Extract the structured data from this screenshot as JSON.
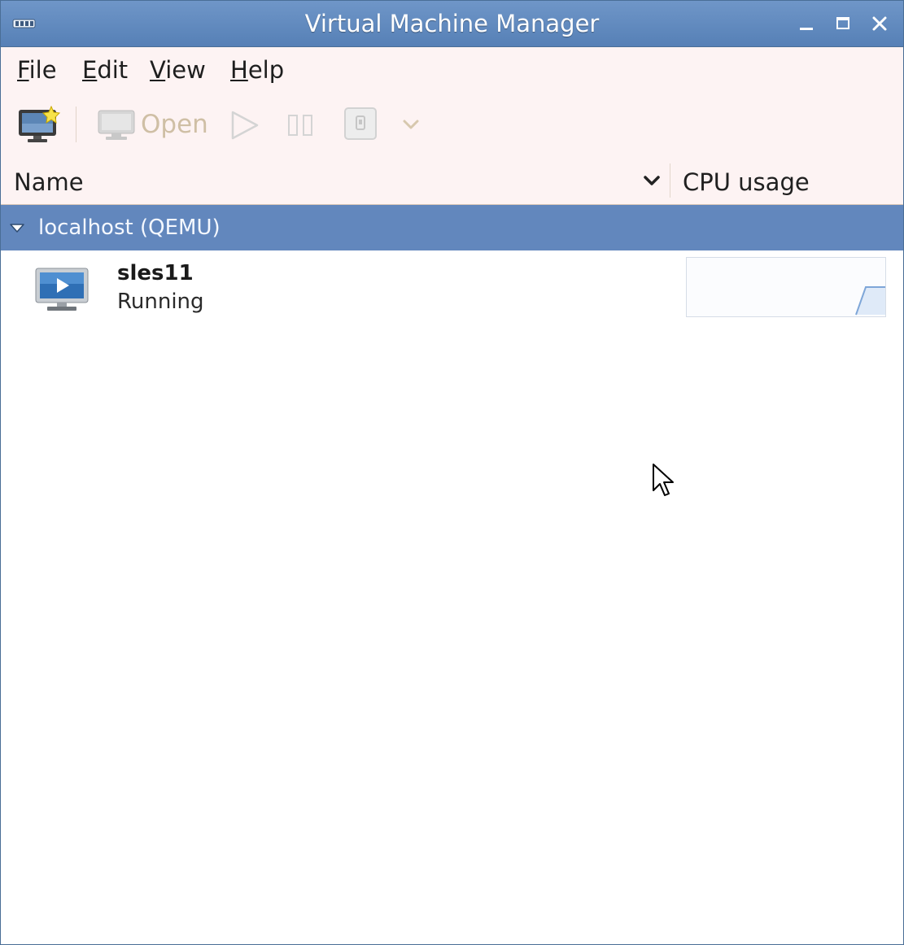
{
  "window": {
    "title": "Virtual Machine Manager",
    "icons": {
      "app": "vm-manager-icon",
      "minimize": "minimize-icon",
      "maximize": "maximize-icon",
      "close": "close-icon"
    }
  },
  "menubar": {
    "items": [
      {
        "mnemonic": "F",
        "rest": "ile"
      },
      {
        "mnemonic": "E",
        "rest": "dit"
      },
      {
        "mnemonic": "V",
        "rest": "iew"
      },
      {
        "mnemonic": "H",
        "rest": "elp"
      }
    ]
  },
  "toolbar": {
    "open_label": "Open",
    "icons": [
      "new-vm-icon",
      "open-console-icon",
      "run-icon",
      "pause-icon",
      "shutdown-icon",
      "chevron-down-icon"
    ]
  },
  "columns": {
    "name": "Name",
    "cpu": "CPU usage"
  },
  "connection": {
    "label": "localhost (QEMU)",
    "expanded": true
  },
  "vms": [
    {
      "name": "sles11",
      "status": "Running",
      "icon": "vm-running-icon"
    }
  ],
  "colors": {
    "titlebar": "#5f87bb",
    "menubar_bg": "#fdf3f3",
    "host_row": "#6287bd",
    "graph_line": "#7ea6d8"
  }
}
